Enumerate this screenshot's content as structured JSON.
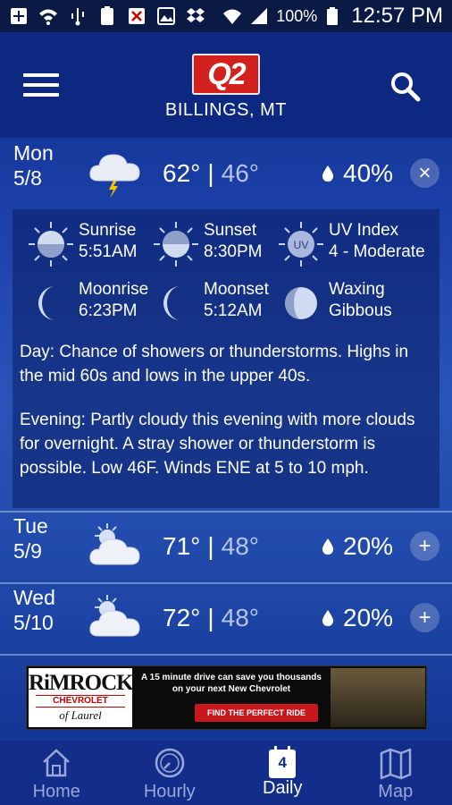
{
  "status_bar": {
    "battery_percent": "100%",
    "time": "12:57 PM",
    "icons": [
      "add-box-icon",
      "wifi-icon",
      "usb-icon",
      "battery-100-icon",
      "blocked-icon",
      "image-icon",
      "dropbox-icon",
      "wifi-signal-icon",
      "cell-signal-icon",
      "battery-icon"
    ]
  },
  "header": {
    "logo_text": "Q2",
    "location": "BILLINGS, MT"
  },
  "days": [
    {
      "dow": "Mon",
      "date": "5/8",
      "hi": "62°",
      "sep": "|",
      "lo": "46°",
      "precip": "40%",
      "icon": "thunderstorm-icon",
      "toggle": "×",
      "expanded": true
    },
    {
      "dow": "Tue",
      "date": "5/9",
      "hi": "71°",
      "sep": "|",
      "lo": "48°",
      "precip": "20%",
      "icon": "partly-cloudy-icon",
      "toggle": "+",
      "expanded": false
    },
    {
      "dow": "Wed",
      "date": "5/10",
      "hi": "72°",
      "sep": "|",
      "lo": "48°",
      "precip": "20%",
      "icon": "partly-cloudy-icon",
      "toggle": "+",
      "expanded": false
    }
  ],
  "details": {
    "sunrise": {
      "label": "Sunrise",
      "value": "5:51AM"
    },
    "sunset": {
      "label": "Sunset",
      "value": "8:30PM"
    },
    "uv": {
      "label": "UV Index",
      "value": "4 - Moderate",
      "badge": "UV"
    },
    "moonrise": {
      "label": "Moonrise",
      "value": "6:23PM"
    },
    "moonset": {
      "label": "Moonset",
      "value": "5:12AM"
    },
    "moon_phase": {
      "line1": "Waxing",
      "line2": "Gibbous"
    },
    "day_text": "Day: Chance of showers or thunderstorms. Highs in the mid 60s and lows in the upper 40s.",
    "evening_text": "Evening: Partly cloudy this evening with more clouds for overnight. A stray shower or thunderstorm is possible. Low 46F. Winds ENE at 5 to 10 mph."
  },
  "ad": {
    "brand_line1": "RiMROCK",
    "brand_line2": "CHEVROLET",
    "brand_line3": "of Laurel",
    "copy": "A 15 minute drive can save you thousands on your next New Chevrolet",
    "cta": "FIND THE PERFECT RIDE"
  },
  "nav": {
    "items": [
      {
        "label": "Home",
        "icon": "home-icon"
      },
      {
        "label": "Hourly",
        "icon": "clock-icon"
      },
      {
        "label": "Daily",
        "icon": "calendar-icon",
        "badge": "4",
        "active": true
      },
      {
        "label": "Map",
        "icon": "map-icon"
      }
    ]
  },
  "colors": {
    "header_bg": "#0d2880",
    "status_bg": "#0a1a44",
    "nav_bg": "#122d8a",
    "logo_red": "#d3211f",
    "low_temp": "#b8c4e6"
  }
}
